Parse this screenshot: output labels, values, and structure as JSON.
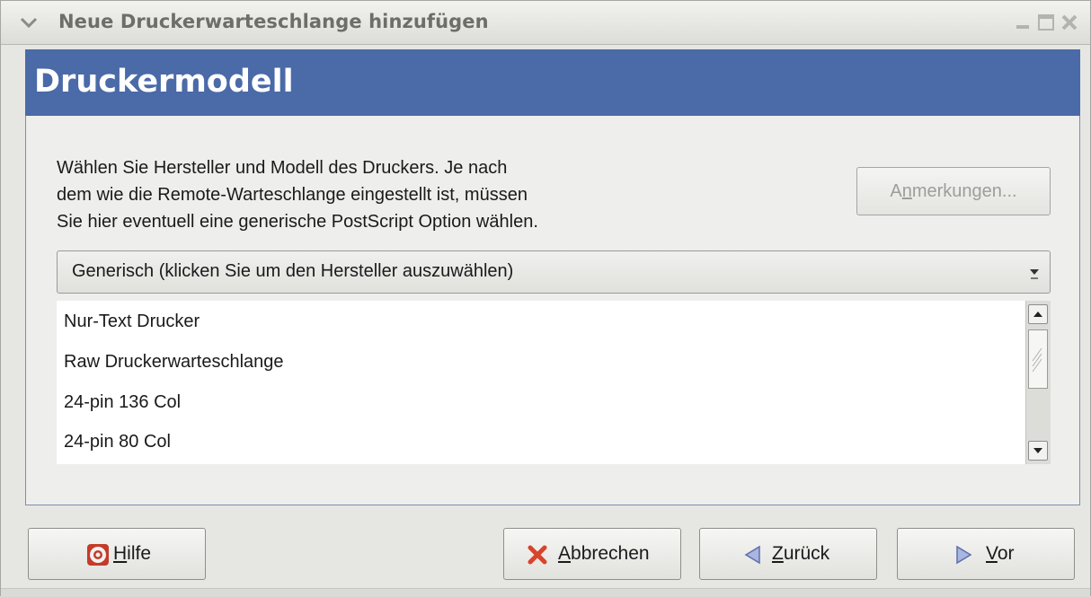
{
  "window": {
    "title": "Neue Druckerwarteschlange hinzufügen"
  },
  "banner": {
    "heading": "Druckermodell"
  },
  "description": {
    "lines": [
      "Wählen Sie Hersteller und Modell des Druckers. Je nach",
      "dem wie die Remote-Warteschlange eingestellt ist, müssen",
      "Sie hier eventuell eine generische PostScript Option wählen."
    ]
  },
  "notes_button": {
    "pre": "A",
    "mnemonic": "n",
    "post": "merkungen..."
  },
  "manufacturer_combo": {
    "selected": "Generisch (klicken Sie um den Hersteller auszuwählen)"
  },
  "model_list": {
    "items": [
      "Nur-Text Drucker",
      "Raw Druckerwarteschlange",
      "24-pin 136 Col",
      "24-pin 80 Col"
    ]
  },
  "buttons": {
    "help": {
      "mnemonic": "H",
      "rest": "ilfe",
      "icon": "lifebuoy-icon"
    },
    "cancel": {
      "mnemonic": "A",
      "rest": "bbrechen",
      "icon": "red-x-icon"
    },
    "back": {
      "mnemonic": "Z",
      "rest": "urück",
      "icon": "left-arrow-icon"
    },
    "forward": {
      "mnemonic": "V",
      "rest": "or",
      "icon": "right-arrow-icon"
    }
  },
  "colors": {
    "banner": "#4a6aa8",
    "cancel_icon": "#d8432b",
    "arrow_icon": "#7f8fc6"
  }
}
